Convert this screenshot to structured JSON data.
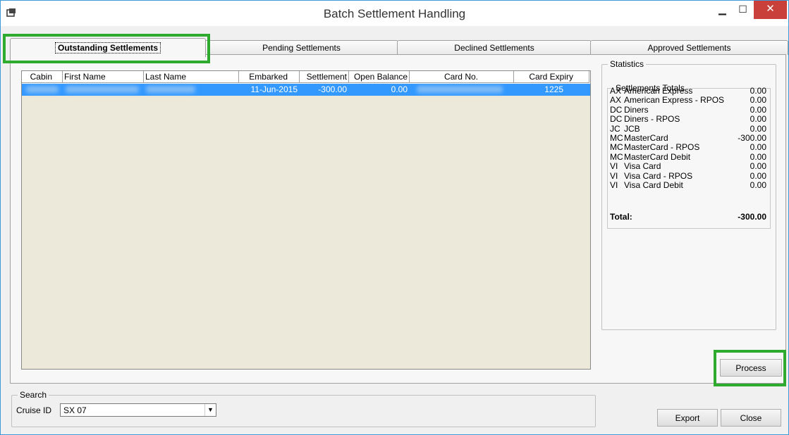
{
  "window": {
    "title": "Batch Settlement Handling",
    "min_glyph": "▁",
    "max_glyph": "☐",
    "close_glyph": "✕"
  },
  "tabs": [
    {
      "label": "Outstanding Settlements",
      "active": true
    },
    {
      "label": "Pending Settlements",
      "active": false
    },
    {
      "label": "Declined Settlements",
      "active": false
    },
    {
      "label": "Approved Settlements",
      "active": false
    }
  ],
  "grid": {
    "columns": [
      "Cabin",
      "First Name",
      "Last Name",
      "Embarked",
      "Settlement",
      "Open Balance",
      "Card No.",
      "Card Expiry"
    ],
    "rows": [
      {
        "cabin": "",
        "first_name": "",
        "last_name": "",
        "embarked": "11-Jun-2015",
        "settlement": "-300.00",
        "open_balance": "0.00",
        "card_no": "",
        "card_expiry": "1225"
      }
    ]
  },
  "statistics": {
    "title": "Statistics",
    "totals_title": "Settlements Totals",
    "items": [
      {
        "code": "AX",
        "name": "American Express",
        "amount": "0.00"
      },
      {
        "code": "AX",
        "name": "American Express - RPOS",
        "amount": "0.00"
      },
      {
        "code": "DC",
        "name": "Diners",
        "amount": "0.00"
      },
      {
        "code": "DC",
        "name": "Diners - RPOS",
        "amount": "0.00"
      },
      {
        "code": "JC",
        "name": "JCB",
        "amount": "0.00"
      },
      {
        "code": "MC",
        "name": "MasterCard",
        "amount": "-300.00"
      },
      {
        "code": "MC",
        "name": "MasterCard - RPOS",
        "amount": "0.00"
      },
      {
        "code": "MC",
        "name": "MasterCard Debit",
        "amount": "0.00"
      },
      {
        "code": "VI",
        "name": "Visa Card",
        "amount": "0.00"
      },
      {
        "code": "VI",
        "name": "Visa Card - RPOS",
        "amount": "0.00"
      },
      {
        "code": "VI",
        "name": "Visa Card Debit",
        "amount": "0.00"
      }
    ],
    "total_label": "Total:",
    "total_amount": "-300.00"
  },
  "buttons": {
    "process": "Process",
    "export": "Export",
    "close": "Close"
  },
  "search": {
    "title": "Search",
    "cruise_label": "Cruise ID",
    "cruise_value": "SX 07"
  },
  "colors": {
    "highlight": "#2eaa2e",
    "selection": "#3399ff",
    "grid_background": "#ece8da",
    "close_button": "#c9403a"
  }
}
